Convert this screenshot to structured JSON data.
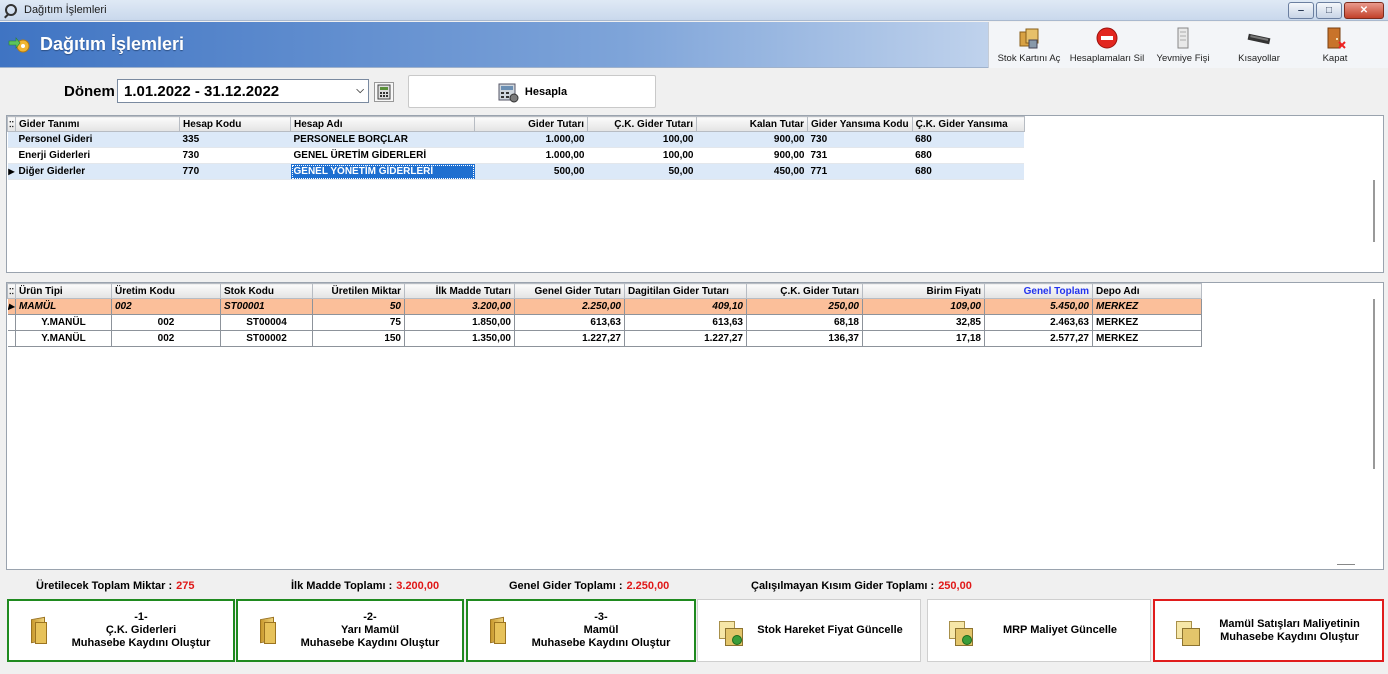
{
  "window": {
    "title": "Dağıtım İşlemleri"
  },
  "header": {
    "title": "Dağıtım İşlemleri"
  },
  "toolbar": {
    "items": [
      {
        "label": "Stok Kartını Aç",
        "icon": "stock-card-icon"
      },
      {
        "label": "Hesaplamaları Sil",
        "icon": "delete-icon"
      },
      {
        "label": "Yevmiye Fişi",
        "icon": "journal-icon"
      },
      {
        "label": "Kısayollar",
        "icon": "keyboard-icon"
      },
      {
        "label": "Kapat",
        "icon": "exit-door-icon"
      }
    ]
  },
  "filter": {
    "donem_label": "Dönem",
    "donem_value": "1.01.2022 - 31.12.2022",
    "hesapla_label": "Hesapla"
  },
  "grid1": {
    "columns": [
      "Gider Tanımı",
      "Hesap Kodu",
      "Hesap Adı",
      "Gider Tutarı",
      "Ç.K. Gider Tutarı",
      "Kalan Tutar",
      "Gider Yansıma Kodu",
      "Ç.K. Gider Yansıma"
    ],
    "rows": [
      {
        "gider_tanimi": "Personel Gideri",
        "hesap_kodu": "335",
        "hesap_adi": "PERSONELE BORÇLAR",
        "gider_tutari": "1.000,00",
        "ck_gider_tutari": "100,00",
        "kalan_tutar": "900,00",
        "gider_yansima_kodu": "730",
        "ck_gider_yansima": "680"
      },
      {
        "gider_tanimi": "Enerji Giderleri",
        "hesap_kodu": "730",
        "hesap_adi": "GENEL ÜRETİM GİDERLERİ",
        "gider_tutari": "1.000,00",
        "ck_gider_tutari": "100,00",
        "kalan_tutar": "900,00",
        "gider_yansima_kodu": "731",
        "ck_gider_yansima": "680"
      },
      {
        "gider_tanimi": "Diğer Giderler",
        "hesap_kodu": "770",
        "hesap_adi": "GENEL YÖNETİM GİDERLERİ",
        "gider_tutari": "500,00",
        "ck_gider_tutari": "50,00",
        "kalan_tutar": "450,00",
        "gider_yansima_kodu": "771",
        "ck_gider_yansima": "680"
      }
    ]
  },
  "grid2": {
    "columns": [
      "Ürün Tipi",
      "Üretim Kodu",
      "Stok Kodu",
      "Üretilen Miktar",
      "İlk Madde Tutarı",
      "Genel Gider Tutarı",
      "Dagitilan Gider Tutarı",
      "Ç.K. Gider Tutarı",
      "Birim Fiyatı",
      "Genel Toplam",
      "Depo Adı"
    ],
    "rows": [
      {
        "urun_tipi": "MAMÜL",
        "uretim_kodu": "002",
        "stok_kodu": "ST00001",
        "uretilen_miktar": "50",
        "ilk_madde_tutari": "3.200,00",
        "genel_gider_tutari": "2.250,00",
        "dagitilan_gider_tutari": "409,10",
        "ck_gider_tutari": "250,00",
        "birim_fiyati": "109,00",
        "genel_toplam": "5.450,00",
        "depo_adi": "MERKEZ"
      },
      {
        "urun_tipi": "Y.MANÜL",
        "uretim_kodu": "002",
        "stok_kodu": "ST00004",
        "uretilen_miktar": "75",
        "ilk_madde_tutari": "1.850,00",
        "genel_gider_tutari": "613,63",
        "dagitilan_gider_tutari": "613,63",
        "ck_gider_tutari": "68,18",
        "birim_fiyati": "32,85",
        "genel_toplam": "2.463,63",
        "depo_adi": "MERKEZ"
      },
      {
        "urun_tipi": "Y.MANÜL",
        "uretim_kodu": "002",
        "stok_kodu": "ST00002",
        "uretilen_miktar": "150",
        "ilk_madde_tutari": "1.350,00",
        "genel_gider_tutari": "1.227,27",
        "dagitilan_gider_tutari": "1.227,27",
        "ck_gider_tutari": "136,37",
        "birim_fiyati": "17,18",
        "genel_toplam": "2.577,27",
        "depo_adi": "MERKEZ"
      }
    ]
  },
  "summary": {
    "uretilecek_label": "Üretilecek Toplam Miktar :",
    "uretilecek_value": "275",
    "ilk_madde_label": "İlk Madde Toplamı :",
    "ilk_madde_value": "3.200,00",
    "genel_gider_label": "Genel Gider Toplamı :",
    "genel_gider_value": "2.250,00",
    "calisilmayan_label": "Çalışılmayan Kısım Gider Toplamı :",
    "calisilmayan_value": "250,00"
  },
  "actions": {
    "btn1": "-1-\nÇ.K. Giderleri\nMuhasebe Kaydını Oluştur",
    "btn2": "-2-\nYarı Mamül\nMuhasebe Kaydını Oluştur",
    "btn3": "-3-\nMamül\nMuhasebe Kaydını Oluştur",
    "btn4": "Stok Hareket Fiyat Güncelle",
    "btn5": "MRP Maliyet Güncelle",
    "btn6": "Mamül Satışları Maliyetinin\nMuhasebe Kaydını Oluştur"
  },
  "colors": {
    "accent_blue": "#3f74c3",
    "selected_row": "#dce9f8",
    "highlight_orange": "#fbbf9a",
    "value_red": "#e01818",
    "green_border": "#1f8a1f",
    "red_border": "#e01c1c"
  }
}
